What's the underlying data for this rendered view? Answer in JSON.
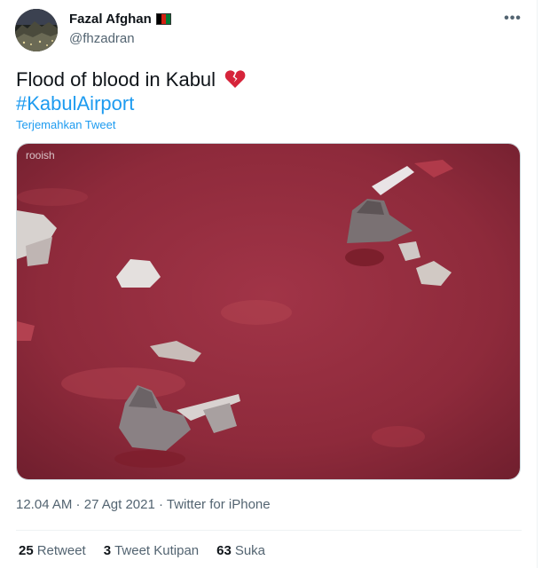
{
  "author": {
    "name": "Fazal Afghan",
    "handle": "@fhzadran",
    "flag_colors": [
      "#000000",
      "#d32011",
      "#007a36"
    ],
    "avatar_icon": "profile-photo"
  },
  "more_icon": "more-horizontal-icon",
  "tweet": {
    "text": "Flood of blood in Kabul",
    "emoji": "broken-heart-icon",
    "hashtag": "#KabulAirport",
    "translate_label": "Terjemahkan Tweet",
    "media_watermark": "rooish"
  },
  "meta": {
    "time": "12.04 AM",
    "date": "27 Agt 2021",
    "source": "Twitter for iPhone",
    "separator": " · "
  },
  "stats": [
    {
      "count": "25",
      "label": "Retweet"
    },
    {
      "count": "3",
      "label": "Tweet Kutipan"
    },
    {
      "count": "63",
      "label": "Suka"
    }
  ],
  "colors": {
    "accent": "#1d9bf0",
    "secondary_text": "#536471",
    "heart": "#d6243a",
    "water": "#8e2a3b"
  }
}
